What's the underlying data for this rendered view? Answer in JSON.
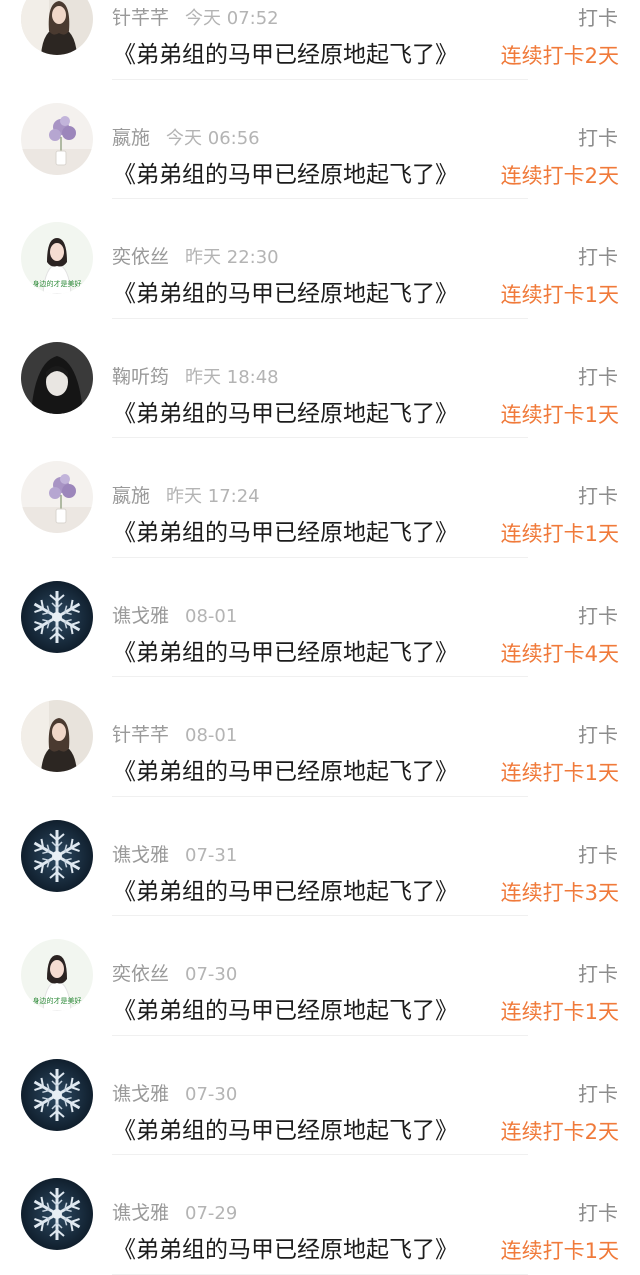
{
  "feed": {
    "items": [
      {
        "user": "针芊芊",
        "time": "今天 07:52",
        "title": "《弟弟组的马甲已经原地起飞了》",
        "type": "打卡",
        "streak": "连续打卡2天",
        "avatar": "girl-portrait"
      },
      {
        "user": "嬴施",
        "time": "今天 06:56",
        "title": "《弟弟组的马甲已经原地起飞了》",
        "type": "打卡",
        "streak": "连续打卡2天",
        "avatar": "flower-vase"
      },
      {
        "user": "奕依丝",
        "time": "昨天 22:30",
        "title": "《弟弟组的马甲已经原地起飞了》",
        "type": "打卡",
        "streak": "连续打卡1天",
        "avatar": "girl-caption",
        "avatar_caption": "身边的才是美好"
      },
      {
        "user": "鞠听筠",
        "time": "昨天 18:48",
        "title": "《弟弟组的马甲已经原地起飞了》",
        "type": "打卡",
        "streak": "连续打卡1天",
        "avatar": "dark-hood"
      },
      {
        "user": "嬴施",
        "time": "昨天 17:24",
        "title": "《弟弟组的马甲已经原地起飞了》",
        "type": "打卡",
        "streak": "连续打卡1天",
        "avatar": "flower-vase"
      },
      {
        "user": "谯戈雅",
        "time": "08-01",
        "title": "《弟弟组的马甲已经原地起飞了》",
        "type": "打卡",
        "streak": "连续打卡4天",
        "avatar": "snowflake"
      },
      {
        "user": "针芊芊",
        "time": "08-01",
        "title": "《弟弟组的马甲已经原地起飞了》",
        "type": "打卡",
        "streak": "连续打卡1天",
        "avatar": "girl-portrait"
      },
      {
        "user": "谯戈雅",
        "time": "07-31",
        "title": "《弟弟组的马甲已经原地起飞了》",
        "type": "打卡",
        "streak": "连续打卡3天",
        "avatar": "snowflake"
      },
      {
        "user": "奕依丝",
        "time": "07-30",
        "title": "《弟弟组的马甲已经原地起飞了》",
        "type": "打卡",
        "streak": "连续打卡1天",
        "avatar": "girl-caption",
        "avatar_caption": "身边的才是美好"
      },
      {
        "user": "谯戈雅",
        "time": "07-30",
        "title": "《弟弟组的马甲已经原地起飞了》",
        "type": "打卡",
        "streak": "连续打卡2天",
        "avatar": "snowflake"
      },
      {
        "user": "谯戈雅",
        "time": "07-29",
        "title": "《弟弟组的马甲已经原地起飞了》",
        "type": "打卡",
        "streak": "连续打卡1天",
        "avatar": "snowflake"
      }
    ]
  },
  "colors": {
    "accent": "#f07a3a",
    "username": "#9a9a9a",
    "timestamp": "#b4b4b4",
    "title": "#1c1c1c",
    "type_label": "#8c8c8c"
  }
}
